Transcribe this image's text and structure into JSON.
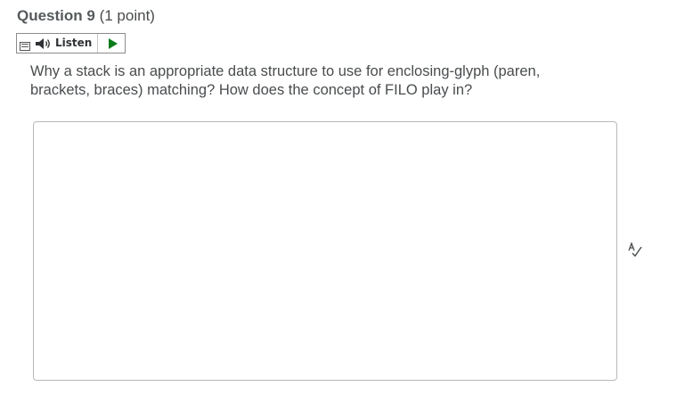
{
  "question": {
    "title": "Question 9",
    "points": "(1 point)",
    "text": "Why a stack is an appropriate data structure to use for enclosing-glyph (paren, brackets, braces) matching? How does the concept of FILO play in?"
  },
  "listen": {
    "label": "Listen",
    "icons": {
      "menu": "menu-icon",
      "speaker": "speaker-icon",
      "play": "play-icon"
    },
    "play_color": "#0a7d1a"
  },
  "answer": {
    "value": "",
    "spellcheck_icon": "spellcheck-icon"
  }
}
